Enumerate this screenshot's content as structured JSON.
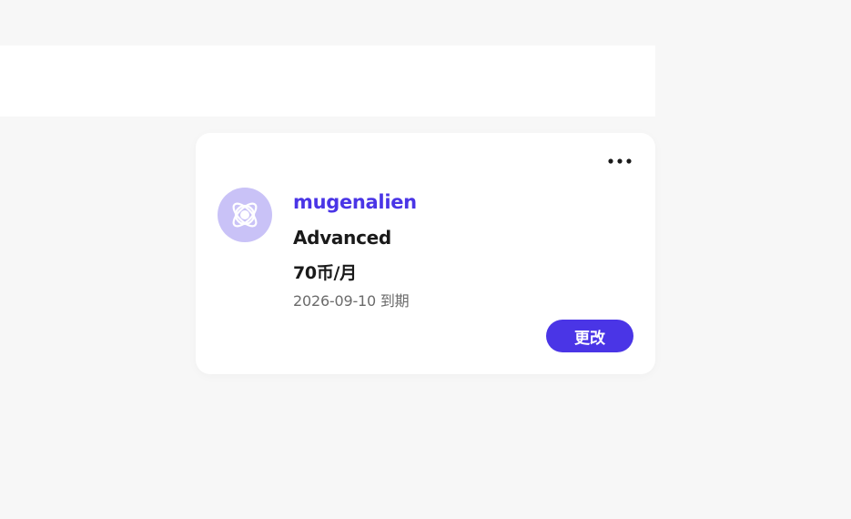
{
  "header_panel": {},
  "subscription_card": {
    "more_icon": "more-horizontal-icon",
    "avatar_icon": "atom-icon",
    "username": "mugenalien",
    "plan_name": "Advanced",
    "price": "70币/月",
    "expiry": "2026-09-10 到期",
    "change_button_label": "更改"
  },
  "colors": {
    "accent": "#4a35e6",
    "avatar_bg": "#c9c2f7",
    "page_bg": "#f7f7f7",
    "card_bg": "#ffffff",
    "muted_text": "#6b6b6b"
  }
}
